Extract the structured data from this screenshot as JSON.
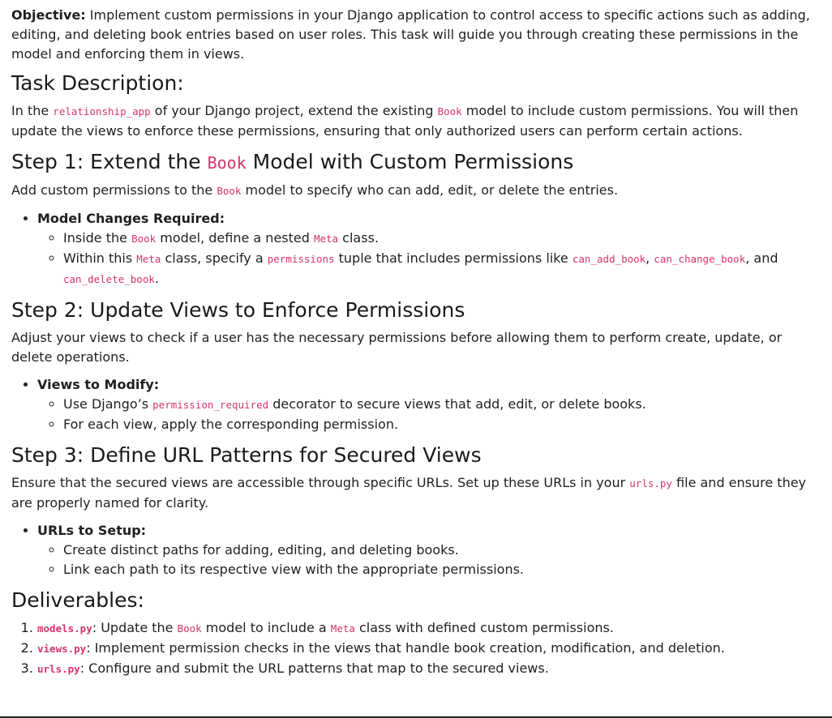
{
  "objective": {
    "label": "Objective:",
    "text": " Implement custom permissions in your Django application to control access to specific actions such as adding, editing, and deleting book entries based on user roles. This task will guide you through creating these permissions in the model and enforcing them in views."
  },
  "task": {
    "heading": "Task Description:",
    "p1": "In the ",
    "code_app": "relationship_app",
    "p2": " of your Django project, extend the existing ",
    "code_book": "Book",
    "p3": " model to include custom permissions. You will then update the views to enforce these permissions, ensuring that only authorized users can perform certain actions."
  },
  "step1": {
    "heading_pre": "Step 1: Extend the ",
    "heading_code": "Book",
    "heading_post": " Model with Custom Permissions",
    "intro_pre": "Add custom permissions to the ",
    "intro_code": "Book",
    "intro_post": " model to specify who can add, edit, or delete the entries.",
    "list_label": "Model Changes Required:",
    "item1_pre": "Inside the ",
    "item1_code1": "Book",
    "item1_mid": " model, define a nested ",
    "item1_code2": "Meta",
    "item1_post": " class.",
    "item2_pre": "Within this ",
    "item2_code1": "Meta",
    "item2_mid1": " class, specify a ",
    "item2_code2": "permissions",
    "item2_mid2": " tuple that includes permissions like ",
    "item2_code3": "can_add_book",
    "item2_sep": ", ",
    "item2_code4": "can_change_book",
    "item2_and": ", and ",
    "item2_code5": "can_delete_book",
    "item2_end": "."
  },
  "step2": {
    "heading": "Step 2: Update Views to Enforce Permissions",
    "intro": "Adjust your views to check if a user has the necessary permissions before allowing them to perform create, update, or delete operations.",
    "list_label": "Views to Modify:",
    "item1_pre": "Use Django’s ",
    "item1_code": "permission_required",
    "item1_post": " decorator to secure views that add, edit, or delete books.",
    "item2": "For each view, apply the corresponding permission."
  },
  "step3": {
    "heading": "Step 3: Define URL Patterns for Secured Views",
    "intro_pre": "Ensure that the secured views are accessible through specific URLs. Set up these URLs in your ",
    "intro_code": "urls.py",
    "intro_post": " file and ensure they are properly named for clarity.",
    "list_label": "URLs to Setup:",
    "item1": "Create distinct paths for adding, editing, and deleting books.",
    "item2": "Link each path to its respective view with the appropriate permissions."
  },
  "deliverables": {
    "heading": "Deliverables:",
    "d1_code": "models.py",
    "d1_pre": ": Update the ",
    "d1_code2": "Book",
    "d1_mid": " model to include a ",
    "d1_code3": "Meta",
    "d1_post": " class with defined custom permissions.",
    "d2_code": "views.py",
    "d2_text": ": Implement permission checks in the views that handle book creation, modification, and deletion.",
    "d3_code": "urls.py",
    "d3_text": ": Configure and submit the URL patterns that map to the secured views."
  }
}
